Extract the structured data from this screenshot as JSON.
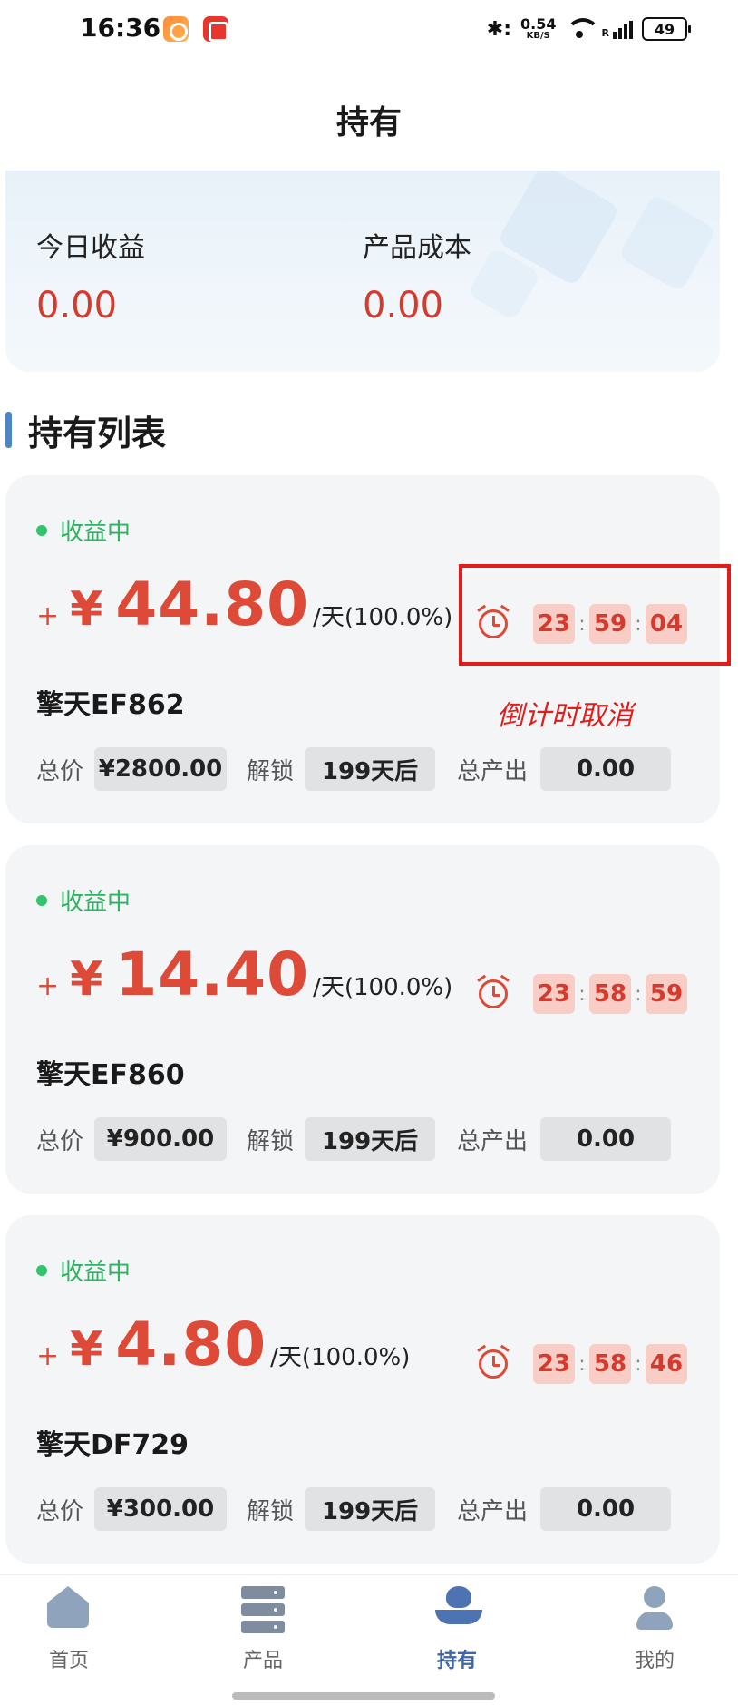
{
  "status_bar": {
    "time": "16:36",
    "bluetooth": "✱:",
    "net_speed_value": "0.54",
    "net_speed_unit": "KB/S",
    "signal_label": "R",
    "battery": "49"
  },
  "header": {
    "title": "持有"
  },
  "summary": {
    "today_income_label": "今日收益",
    "today_income_value": "0.00",
    "product_cost_label": "产品成本",
    "product_cost_value": "0.00"
  },
  "list": {
    "title": "持有列表",
    "items": [
      {
        "status": "收益中",
        "plus": "+",
        "yen": "¥",
        "daily_amount": "44.80",
        "daily_suffix": "/天(100.0%)",
        "countdown": {
          "h": "23",
          "m": "59",
          "s": "04"
        },
        "name": "擎天EF862",
        "price_label": "总价",
        "price": "¥2800.00",
        "unlock_label": "解锁",
        "unlock": "199天后",
        "output_label": "总产出",
        "output": "0.00"
      },
      {
        "status": "收益中",
        "plus": "+",
        "yen": "¥",
        "daily_amount": "14.40",
        "daily_suffix": "/天(100.0%)",
        "countdown": {
          "h": "23",
          "m": "58",
          "s": "59"
        },
        "name": "擎天EF860",
        "price_label": "总价",
        "price": "¥900.00",
        "unlock_label": "解锁",
        "unlock": "199天后",
        "output_label": "总产出",
        "output": "0.00"
      },
      {
        "status": "收益中",
        "plus": "+",
        "yen": "¥",
        "daily_amount": "4.80",
        "daily_suffix": "/天(100.0%)",
        "countdown": {
          "h": "23",
          "m": "58",
          "s": "46"
        },
        "name": "擎天DF729",
        "price_label": "总价",
        "price": "¥300.00",
        "unlock_label": "解锁",
        "unlock": "199天后",
        "output_label": "总产出",
        "output": "0.00"
      }
    ]
  },
  "annotation": {
    "text": "倒计时取消",
    "color": "#e21b1b"
  },
  "bottom_nav": {
    "items": [
      {
        "label": "首页",
        "icon": "home-icon"
      },
      {
        "label": "产品",
        "icon": "server-icon"
      },
      {
        "label": "持有",
        "icon": "hold-icon",
        "active": true
      },
      {
        "label": "我的",
        "icon": "user-icon"
      }
    ]
  },
  "colors": {
    "accent_red": "#de4a38",
    "status_green": "#2bb462",
    "active_blue": "#3f67a8"
  }
}
